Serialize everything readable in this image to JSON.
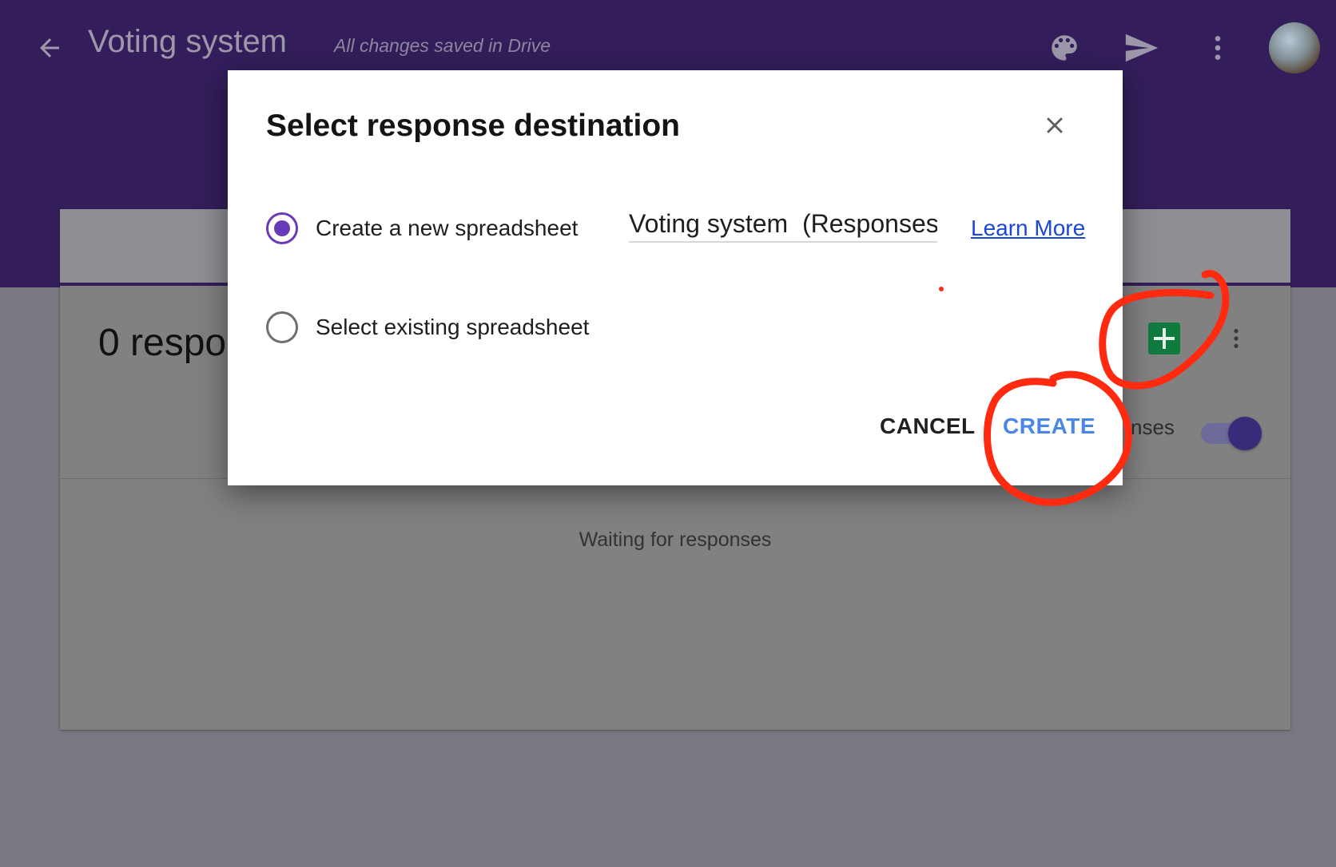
{
  "header": {
    "title": "Voting system",
    "status": "All changes saved in Drive",
    "icons": [
      "arrow-back-icon",
      "palette-icon",
      "send-icon",
      "more-vert-icon"
    ]
  },
  "card": {
    "responses_count": "0 respo",
    "accepting_label": "nses",
    "accepting_on": true,
    "waiting_text": "Waiting for responses"
  },
  "dialog": {
    "title": "Select response destination",
    "option_new_label": "Create a new spreadsheet",
    "option_new_selected": true,
    "option_existing_label": "Select existing spreadsheet",
    "option_existing_selected": false,
    "spreadsheet_name_value": "Voting system  (Responses)",
    "learn_more_label": "Learn More",
    "cancel_label": "CANCEL",
    "create_label": "CREATE"
  },
  "colors": {
    "header_bg": "#331e5b",
    "accent_purple": "#673ab7",
    "create_blue": "#4a86e8",
    "sheets_green": "#0f7b3e",
    "annotation_red": "#ff2a10"
  }
}
